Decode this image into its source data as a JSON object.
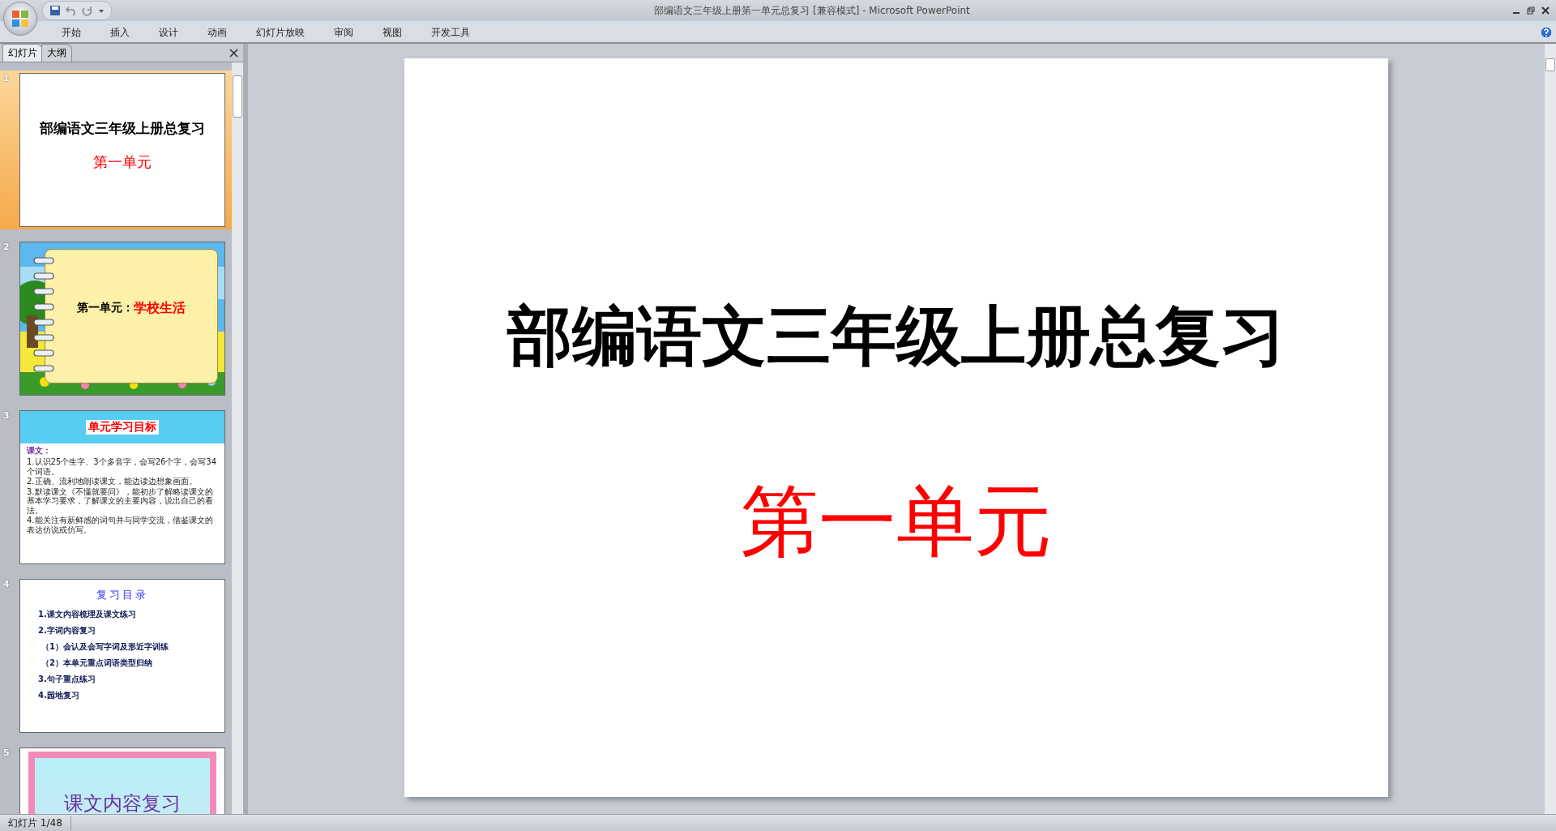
{
  "window": {
    "title": "部编语文三年级上册第一单元总复习 [兼容模式] - Microsoft PowerPoint"
  },
  "ribbon_tabs": [
    {
      "label": "开始",
      "selected": false
    },
    {
      "label": "插入",
      "selected": false
    },
    {
      "label": "设计",
      "selected": false
    },
    {
      "label": "动画",
      "selected": false
    },
    {
      "label": "幻灯片放映",
      "selected": false
    },
    {
      "label": "审阅",
      "selected": false
    },
    {
      "label": "视图",
      "selected": false
    },
    {
      "label": "开发工具",
      "selected": false
    }
  ],
  "panel_tabs": [
    {
      "label": "幻灯片",
      "selected": true
    },
    {
      "label": "大纲",
      "selected": false
    }
  ],
  "slides": [
    {
      "number": "1",
      "selected": true,
      "kind": "title",
      "title": "部编语文三年级上册总复习",
      "subtitle": "第一单元"
    },
    {
      "number": "2",
      "selected": false,
      "kind": "notebook",
      "prefix": "第一单元：",
      "highlight": "学校生活"
    },
    {
      "number": "3",
      "selected": false,
      "kind": "goals",
      "heading": "单元学习目标",
      "label": "课文：",
      "lines": [
        "1.认识25个生字、3个多音字，会写26个字，会写34个词语。",
        "2.正确、流利地朗读课文，能边读边想象画面。",
        "3.默读课文《不懂就要问》，能初步了解略读课文的基本学习要求，了解课文的主要内容，说出自己的看法。",
        "4.能关注有新鲜感的词句并与同学交流，借鉴课文的表达仿说或仿写。"
      ]
    },
    {
      "number": "4",
      "selected": false,
      "kind": "contents",
      "heading": "复习目录",
      "items": [
        {
          "text": "1.课文内容梳理及课文练习"
        },
        {
          "text": "2.字词内容复习",
          "children": [
            "（1）会认及会写字词及形近字训练",
            "（2）本单元重点词语类型归纳"
          ]
        },
        {
          "text": "3.句子重点练习"
        },
        {
          "text": "4.园地复习"
        }
      ]
    },
    {
      "number": "5",
      "selected": false,
      "kind": "section",
      "title": "课文内容复习"
    }
  ],
  "main_slide": {
    "title": "部编语文三年级上册总复习",
    "subtitle": "第一单元"
  },
  "status_bar": {
    "text": "幻灯片 1/48"
  }
}
